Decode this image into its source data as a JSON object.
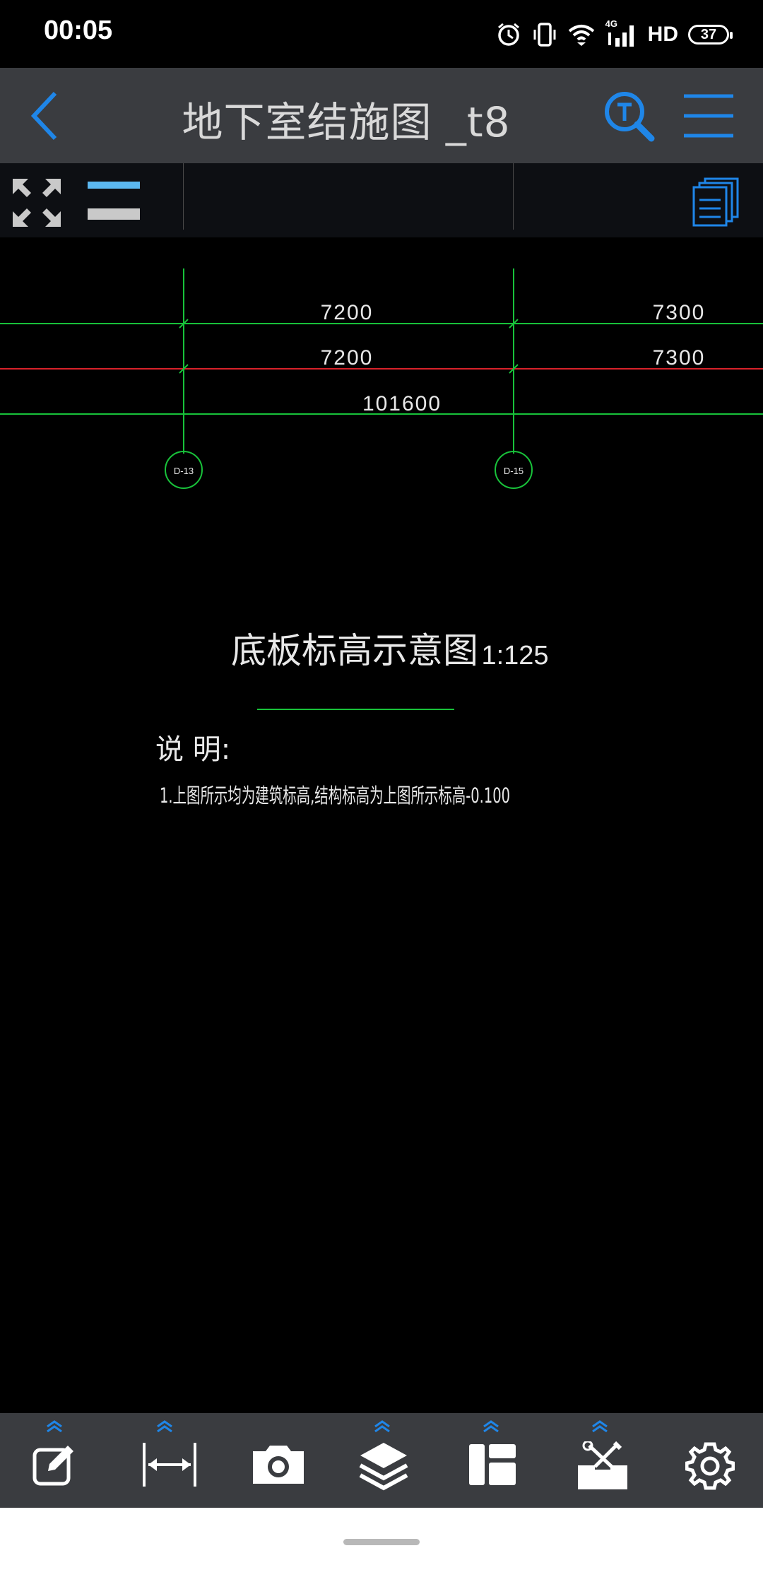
{
  "status_bar": {
    "time": "00:05",
    "network": "4G",
    "hd": "HD",
    "battery": "37",
    "icons": [
      "alarm-icon",
      "vibrate-icon",
      "wifi-icon",
      "signal-icon",
      "battery-icon"
    ]
  },
  "header": {
    "title": "地下室结施图 _t8",
    "icons": [
      "back-arrow-icon",
      "text-search-icon",
      "menu-icon"
    ],
    "accent": "#1f86e8"
  },
  "toolbar": {
    "icons": [
      "fit-screen-icon",
      "layer-toggle-icon",
      "pages-icon"
    ]
  },
  "drawing": {
    "dimensions_row1": [
      "7200",
      "7300"
    ],
    "dimensions_row2": [
      "7200",
      "7300"
    ],
    "dimension_total": "101600",
    "axis_labels": [
      "D-13",
      "D-15"
    ],
    "section_title": "底板标高示意图",
    "scale": "1:125",
    "notes_heading": "说 明:",
    "note_1": "1.上图所示均为建筑标高,结构标高为上图所示标高-0.100",
    "colors": {
      "grid_green": "#18c23a",
      "dim_red": "#d8222a",
      "text": "#e8e8e8"
    }
  },
  "bottom_toolbar": {
    "tools": [
      "annotate-icon",
      "measure-icon",
      "camera-icon",
      "layers-icon",
      "layout-icon",
      "toolbox-icon",
      "settings-icon"
    ]
  }
}
